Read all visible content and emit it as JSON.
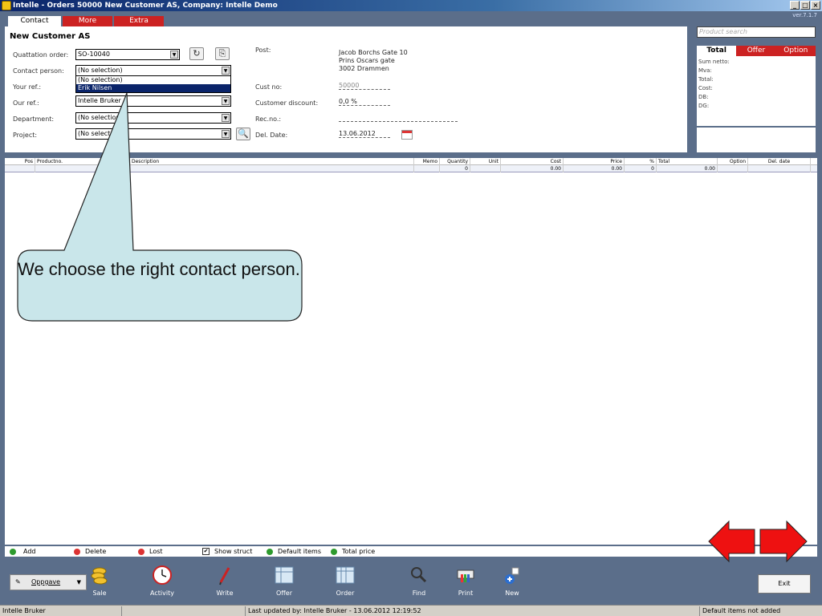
{
  "window": {
    "title": "Intelle - Orders  50000 New Customer AS,  Company: Intelle Demo",
    "version": "ver.7.1.7"
  },
  "tabs": [
    {
      "label": "Contact",
      "active": true
    },
    {
      "label": "More",
      "active": false
    },
    {
      "label": "Extra",
      "active": false
    }
  ],
  "customer": {
    "name": "New Customer AS"
  },
  "form": {
    "quotation_order_label": "Quattation order:",
    "quotation_order_value": "SO-10040",
    "contact_person_label": "Contact person:",
    "contact_person_value": "(No selection)",
    "contact_options": [
      "(No selection)",
      "Erik Nilsen"
    ],
    "your_ref_label": "Your ref.:",
    "our_ref_label": "Our ref.:",
    "our_ref_value": "Intelle Bruker",
    "department_label": "Department:",
    "department_value": "(No selection",
    "project_label": "Project:",
    "project_value": "(No select",
    "post_label": "Post:",
    "post_lines": [
      "Jacob Borchs Gate 10",
      "Prins Oscars gate",
      "3002 Drammen"
    ],
    "cust_no_label": "Cust no:",
    "cust_no_value": "50000",
    "discount_label": "Customer discount:",
    "discount_value": "0,0 %",
    "rec_no_label": "Rec.no.:",
    "del_date_label": "Del. Date:",
    "del_date_value": "13.06.2012"
  },
  "search": {
    "placeholder": "Product search"
  },
  "totals": {
    "tabs": [
      "Total",
      "Offer",
      "Option"
    ],
    "rows": [
      "Sum netto:",
      "Mva:",
      "Total:",
      "Cost:",
      "DB:",
      "DG:"
    ]
  },
  "grid": {
    "headers": [
      "Pos",
      "Productno.",
      "Description",
      "Memo",
      "Quantity",
      "Unit",
      "Cost",
      "Price",
      "%",
      "Total",
      "Option",
      "Del. date"
    ],
    "row": {
      "quantity": "0",
      "cost": "0.00",
      "price": "0.00",
      "pct": "0",
      "total": "0.00"
    }
  },
  "bottom_actions": {
    "add": "Add",
    "delete": "Delete",
    "lost": "Lost",
    "show_struct": "Show struct",
    "show_struct_checked": "✔",
    "default_items": "Default items",
    "total_price": "Total price"
  },
  "toolbar": {
    "oppgave": "Oppgave",
    "items": [
      "Sale",
      "Activity",
      "Write",
      "Offer",
      "Order",
      "Find",
      "Print",
      "New"
    ],
    "exit": "Exit"
  },
  "status": {
    "user": "Intelle Bruker",
    "last_updated": "Last updated by: Intelle Bruker - 13.06.2012 12:19:52",
    "default_items": "Default items not added"
  },
  "callout": {
    "text": "We choose the right contact person."
  },
  "colors": {
    "tab_red": "#cc2222",
    "app_bg": "#5b6e8a",
    "callout_fill": "#c9e6ea",
    "arrow_red": "#ee1111"
  }
}
